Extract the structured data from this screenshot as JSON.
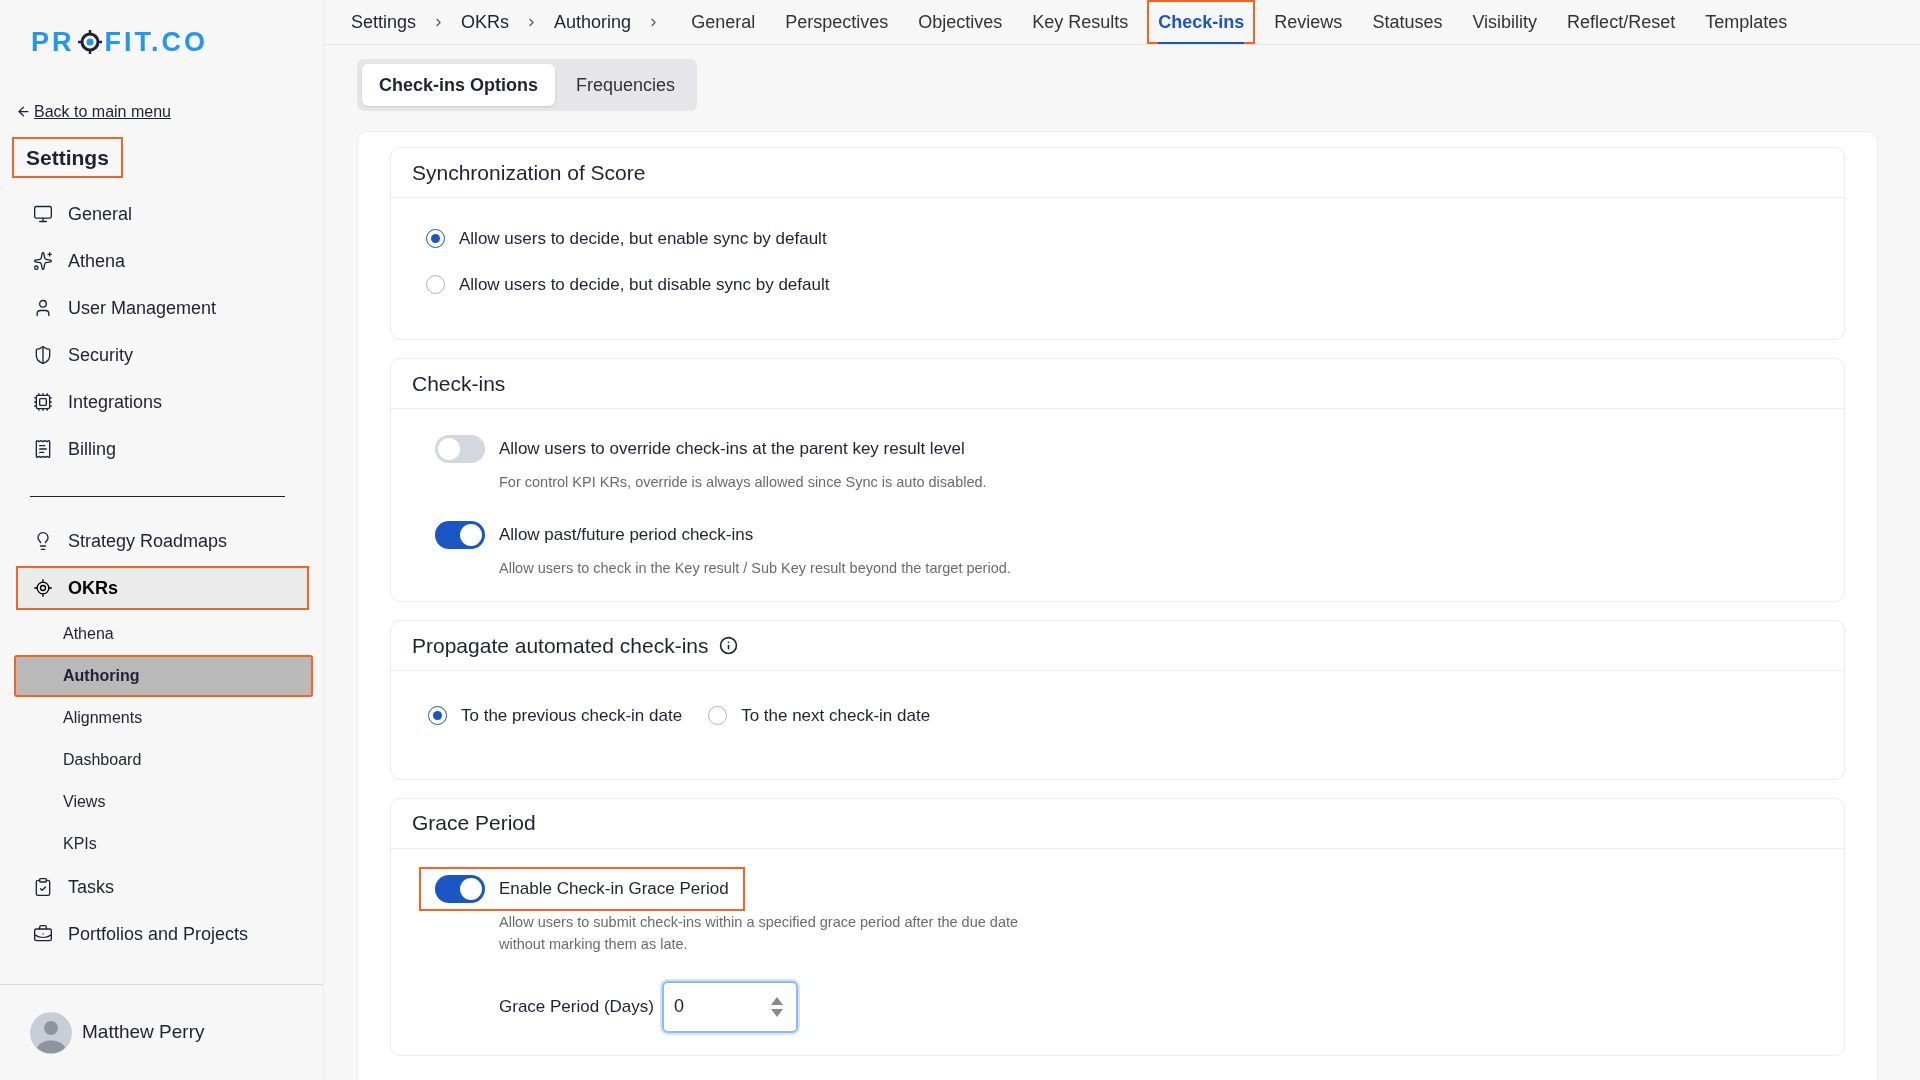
{
  "logo": {
    "before": "PR",
    "after": "FIT.CO"
  },
  "back_link": "Back to main menu",
  "sidebar": {
    "title": {
      "text": "Settings",
      "highlighted": true
    },
    "sections": [
      {
        "items": [
          {
            "label": "General",
            "selected": false,
            "highlighted": false
          },
          {
            "label": "Athena",
            "selected": false,
            "highlighted": false
          },
          {
            "label": "User Management",
            "selected": false,
            "highlighted": false
          },
          {
            "label": "Security",
            "selected": false,
            "highlighted": false
          },
          {
            "label": "Integrations",
            "selected": false,
            "highlighted": false
          },
          {
            "label": "Billing",
            "selected": false,
            "highlighted": false
          }
        ]
      },
      {
        "items": [
          {
            "label": "Strategy Roadmaps",
            "selected": false,
            "highlighted": false
          },
          {
            "label": "OKRs",
            "selected": true,
            "highlighted": true,
            "children": [
              {
                "label": "Athena",
                "selected": false,
                "highlighted": false
              },
              {
                "label": "Authoring",
                "selected": true,
                "highlighted": true
              },
              {
                "label": "Alignments",
                "selected": false,
                "highlighted": false
              },
              {
                "label": "Dashboard",
                "selected": false,
                "highlighted": false
              },
              {
                "label": "Views",
                "selected": false,
                "highlighted": false
              },
              {
                "label": "KPIs",
                "selected": false,
                "highlighted": false
              }
            ]
          },
          {
            "label": "Tasks",
            "selected": false,
            "highlighted": false
          },
          {
            "label": "Portfolios and Projects",
            "selected": false,
            "highlighted": false
          }
        ]
      }
    ],
    "user": {
      "name": "Matthew Perry"
    }
  },
  "breadcrumb": [
    "Settings",
    "OKRs",
    "Authoring"
  ],
  "tabs": [
    {
      "label": "General",
      "selected": false,
      "highlighted": false
    },
    {
      "label": "Perspectives",
      "selected": false,
      "highlighted": false
    },
    {
      "label": "Objectives",
      "selected": false,
      "highlighted": false
    },
    {
      "label": "Key Results",
      "selected": false,
      "highlighted": false
    },
    {
      "label": "Check-ins",
      "selected": true,
      "highlighted": true
    },
    {
      "label": "Reviews",
      "selected": false,
      "highlighted": false
    },
    {
      "label": "Statuses",
      "selected": false,
      "highlighted": false
    },
    {
      "label": "Visibility",
      "selected": false,
      "highlighted": false
    },
    {
      "label": "Reflect/Reset",
      "selected": false,
      "highlighted": false
    },
    {
      "label": "Templates",
      "selected": false,
      "highlighted": false
    }
  ],
  "subtabs": [
    {
      "label": "Check-ins Options",
      "selected": true
    },
    {
      "label": "Frequencies",
      "selected": false
    }
  ],
  "sections": [
    {
      "kind": "radio_list",
      "title": "Synchronization of Score",
      "info": false,
      "options": [
        {
          "label": "Allow users to decide, but enable sync by default",
          "selected": true
        },
        {
          "label": "Allow users to decide, but disable sync by default",
          "selected": false
        }
      ]
    },
    {
      "kind": "toggle_list",
      "title": "Check-ins",
      "info": false,
      "toggles": [
        {
          "label": "Allow users to override check-ins at the parent key result level",
          "description": "For control KPI KRs, override is always allowed since Sync is auto disabled.",
          "on": false,
          "highlighted": false
        },
        {
          "label": "Allow past/future period check-ins",
          "description": "Allow users to check in the Key result / Sub Key result beyond the target period.",
          "on": true,
          "highlighted": false
        }
      ]
    },
    {
      "kind": "radio_row",
      "title": "Propagate automated check-ins",
      "info": true,
      "options": [
        {
          "label": "To the previous check-in date",
          "selected": true
        },
        {
          "label": "To the next check-in date",
          "selected": false
        }
      ]
    },
    {
      "kind": "toggle_list",
      "title": "Grace Period",
      "info": false,
      "toggles": [
        {
          "label": "Enable Check-in Grace Period",
          "description": "Allow users to submit check-ins within a specified grace period after the due date without marking them as late.",
          "on": true,
          "highlighted": true
        }
      ],
      "field": {
        "label": "Grace Period (Days)",
        "value": "0"
      }
    }
  ]
}
